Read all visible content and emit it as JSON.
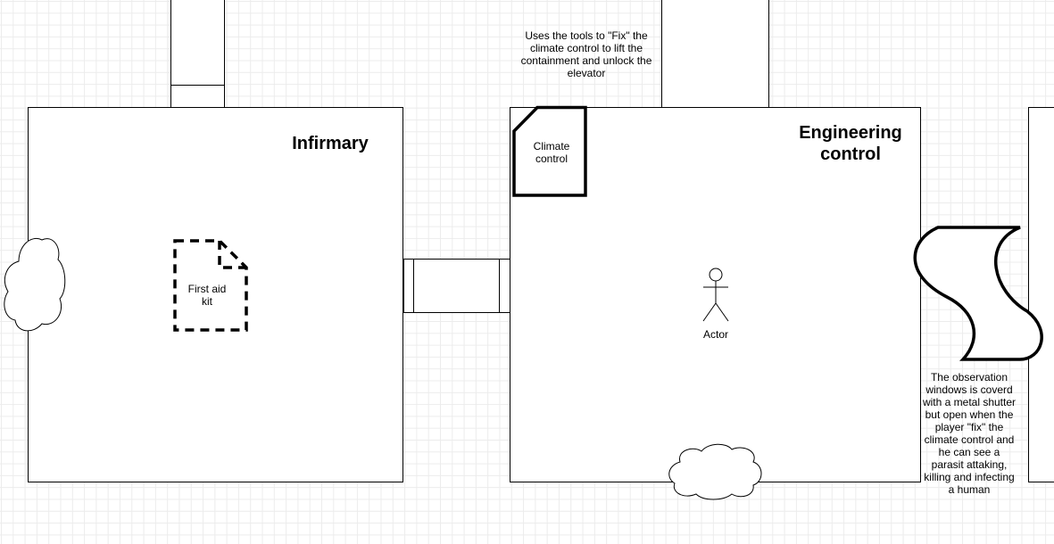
{
  "rooms": {
    "infirmary": {
      "title": "Infirmary"
    },
    "engineering": {
      "title": "Engineering control"
    }
  },
  "items": {
    "first_aid_kit": "First aid kit",
    "climate_control": "Climate control",
    "actor": "Actor"
  },
  "notes": {
    "climate_fix": "Uses the tools to \"Fix\" the climate control to lift the containment and unlock the elevator",
    "observation_window": "The observation windows is coverd with a metal shutter but open when the player \"fix\" the climate control and he can see a parasit attaking, killing and infecting a human"
  },
  "colors": {
    "stroke": "#000000",
    "grid": "#ececec",
    "fill": "#ffffff"
  }
}
